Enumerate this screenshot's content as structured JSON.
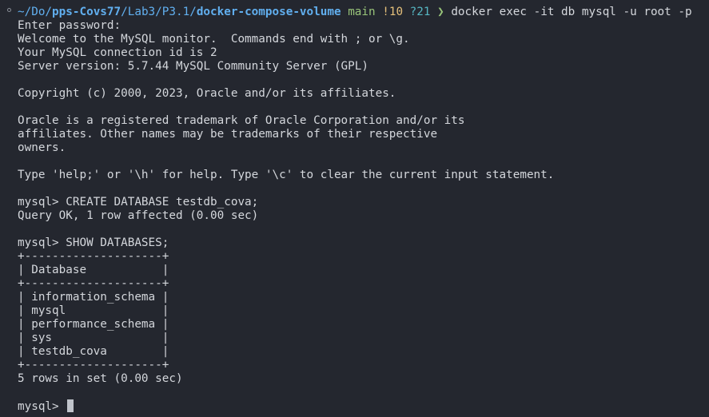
{
  "prompt": {
    "path_prefix": "~/Do/",
    "path_repo": "pps-Covs77",
    "path_mid": "/Lab3/P3.1/",
    "path_dir": "docker-compose-volume",
    "branch": "main",
    "modified": "!10",
    "untracked": "?21",
    "chevron": "❯",
    "command": "docker exec -it db mysql -u root -p"
  },
  "output": [
    "Enter password:",
    "Welcome to the MySQL monitor.  Commands end with ; or \\g.",
    "Your MySQL connection id is 2",
    "Server version: 5.7.44 MySQL Community Server (GPL)",
    "",
    "Copyright (c) 2000, 2023, Oracle and/or its affiliates.",
    "",
    "Oracle is a registered trademark of Oracle Corporation and/or its",
    "affiliates. Other names may be trademarks of their respective",
    "owners.",
    "",
    "Type 'help;' or '\\h' for help. Type '\\c' to clear the current input statement.",
    "",
    "mysql> CREATE DATABASE testdb_cova;",
    "Query OK, 1 row affected (0.00 sec)",
    "",
    "mysql> SHOW DATABASES;",
    "+--------------------+",
    "| Database           |",
    "+--------------------+",
    "| information_schema |",
    "| mysql              |",
    "| performance_schema |",
    "| sys                |",
    "| testdb_cova        |",
    "+--------------------+",
    "5 rows in set (0.00 sec)",
    ""
  ],
  "final_prompt": "mysql> "
}
